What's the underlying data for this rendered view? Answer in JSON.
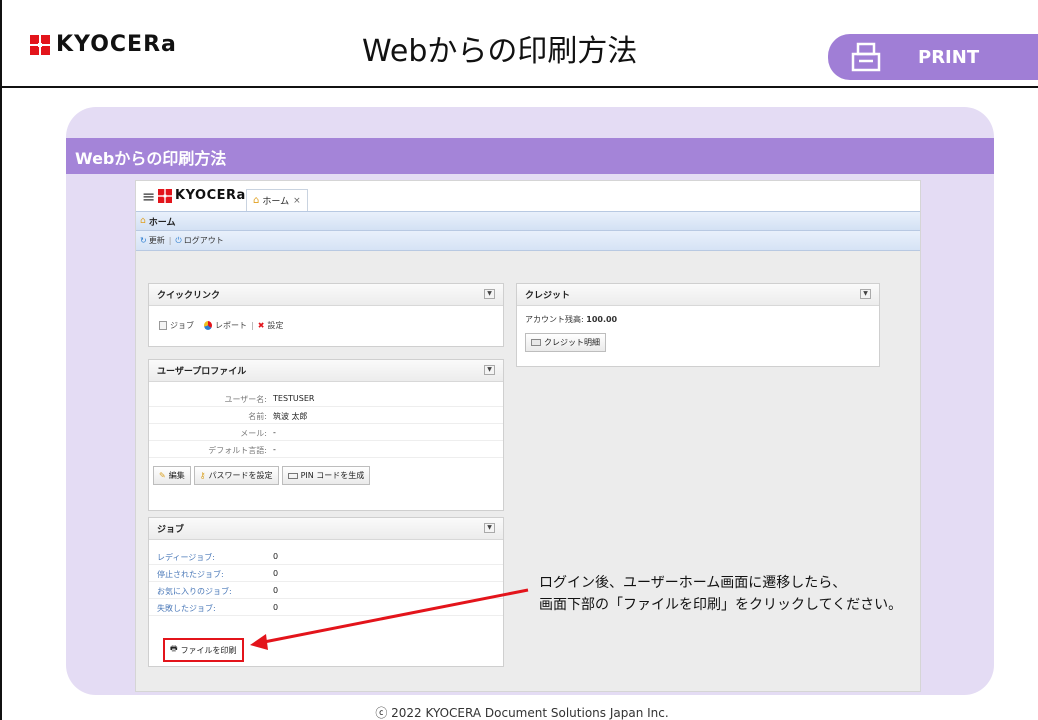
{
  "header": {
    "logo_text": "KYOCERa",
    "title": "Webからの印刷方法",
    "print_tab": "PRINT"
  },
  "panel": {
    "title": "Webからの印刷方法"
  },
  "app": {
    "logo_text": "KYOCERa",
    "home_tab": "ホーム",
    "breadcrumb": "ホーム",
    "refresh": "更新",
    "logout": "ログアウト",
    "quick_links": {
      "title": "クイックリンク",
      "items": [
        "ジョブ",
        "レポート",
        "設定"
      ]
    },
    "profile": {
      "title": "ユーザープロファイル",
      "fields": [
        {
          "label": "ユーザー名:",
          "value": "TESTUSER"
        },
        {
          "label": "名前:",
          "value": "筑波 太郎"
        },
        {
          "label": "メール:",
          "value": "-"
        },
        {
          "label": "デフォルト言語:",
          "value": "-"
        }
      ],
      "buttons": [
        "編集",
        "パスワードを設定",
        "PIN コードを生成"
      ]
    },
    "jobs": {
      "title": "ジョブ",
      "rows": [
        {
          "label": "レディージョブ:",
          "value": "0"
        },
        {
          "label": "停止されたジョブ:",
          "value": "0"
        },
        {
          "label": "お気に入りのジョブ:",
          "value": "0"
        },
        {
          "label": "失敗したジョブ:",
          "value": "0"
        }
      ],
      "print_button": "ファイルを印刷"
    },
    "credit": {
      "title": "クレジット",
      "balance_label": "アカウント残高:",
      "balance_value": "100.00",
      "details_button": "クレジット明細"
    }
  },
  "callout": {
    "line1": "ログイン後、ユーザーホーム画面に遷移したら、",
    "line2": "画面下部の「ファイルを印刷」をクリックしてください。"
  },
  "footer": {
    "copyright": "ⓒ 2022 KYOCERA Document Solutions Japan Inc."
  },
  "colors": {
    "accent_purple": "#a484d8",
    "panel_bg": "#e4dcf4",
    "highlight_red": "#e3141b",
    "logo_red": "#e3141b"
  }
}
